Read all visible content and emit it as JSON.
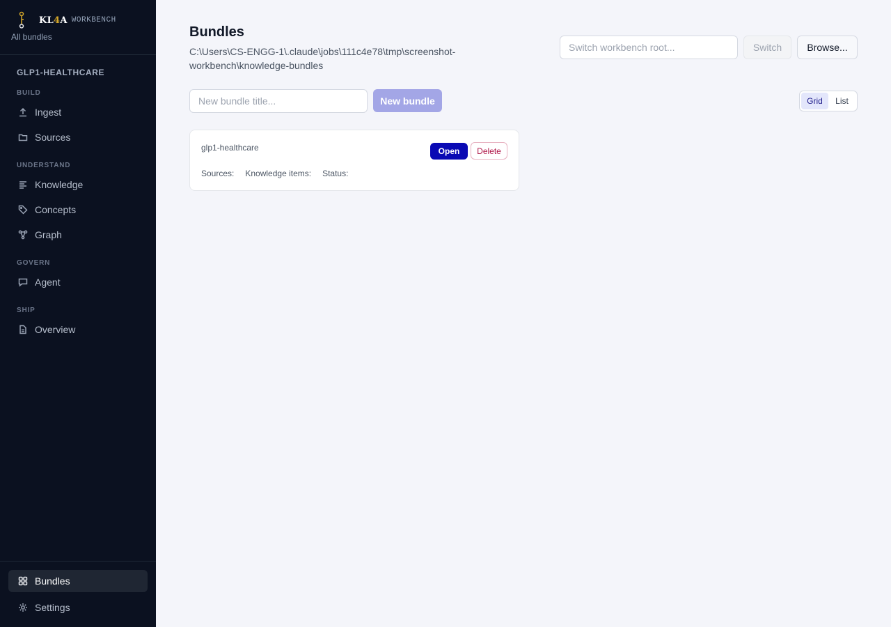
{
  "brand": {
    "name_prefix": "KL",
    "name_accent": "4",
    "name_suffix": "A",
    "subtitle": "WORKBENCH",
    "all_bundles": "All bundles"
  },
  "sidebar": {
    "bundle_name": "GLP1-HEALTHCARE",
    "sections": {
      "build": "BUILD",
      "understand": "UNDERSTAND",
      "govern": "GOVERN",
      "ship": "SHIP"
    },
    "items": {
      "ingest": "Ingest",
      "sources": "Sources",
      "knowledge": "Knowledge",
      "concepts": "Concepts",
      "graph": "Graph",
      "agent": "Agent",
      "overview": "Overview"
    },
    "bottom": {
      "bundles": "Bundles",
      "settings": "Settings"
    }
  },
  "main": {
    "title": "Bundles",
    "path": "C:\\Users\\CS-ENGG-1\\.claude\\jobs\\111c4e78\\tmp\\screenshot-workbench\\knowledge-bundles",
    "root_input_placeholder": "Switch workbench root...",
    "switch_label": "Switch",
    "browse_label": "Browse...",
    "new_title_placeholder": "New bundle title...",
    "new_bundle_label": "New bundle",
    "view_toggle": {
      "grid": "Grid",
      "list": "List",
      "selected": "Grid"
    },
    "cards": [
      {
        "title": "glp1-healthcare",
        "open_label": "Open",
        "delete_label": "Delete",
        "sources_label": "Sources:",
        "knowledge_label": "Knowledge items:",
        "status_label": "Status:"
      }
    ]
  },
  "colors": {
    "sidebar_bg": "#0b1120",
    "primary": "#0a0ab4",
    "primary_disabled": "#a3a6e6",
    "danger": "#b0184a",
    "accent_gold": "#d6a82a"
  }
}
